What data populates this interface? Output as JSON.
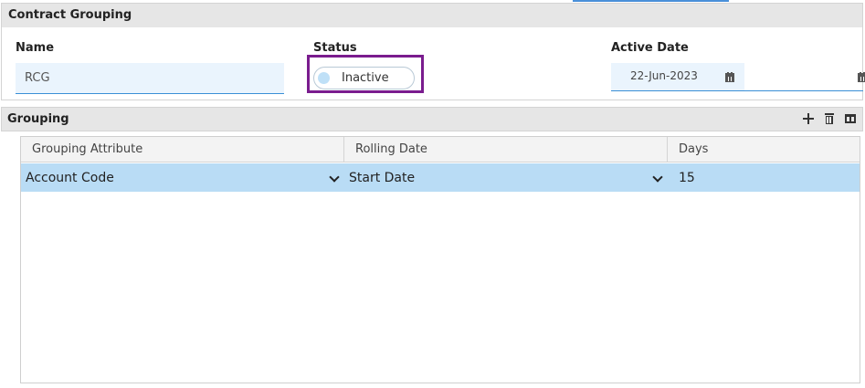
{
  "contract_grouping": {
    "title": "Contract Grouping",
    "name_label": "Name",
    "name_value": "RCG",
    "status_label": "Status",
    "status_value": "Inactive",
    "active_date_label": "Active Date",
    "active_date_value": "22-Jun-2023"
  },
  "grouping": {
    "title": "Grouping",
    "toolbar": [
      "plus-icon",
      "trash-icon",
      "columns-icon"
    ],
    "columns": [
      "Grouping Attribute",
      "Rolling Date",
      "Days"
    ],
    "rows": [
      {
        "attribute": "Account Code",
        "rolling_date": "Start Date",
        "days": "15"
      }
    ]
  },
  "colors": {
    "accent": "#3a8fd6",
    "selected_row": "#b9dcf5",
    "status_highlight": "#7a1c8e",
    "header_bg": "#e6e6e6"
  }
}
